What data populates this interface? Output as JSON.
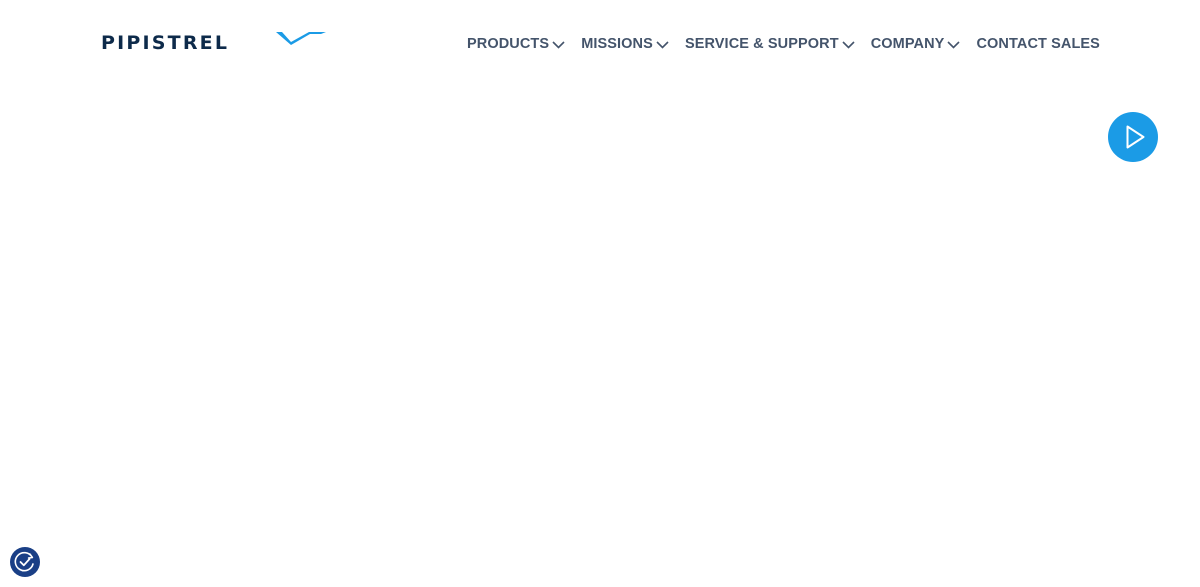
{
  "brand": {
    "name": "PIPISTREL",
    "logo_icon": "swallow-wing-icon",
    "text_color": "#0d2a4a",
    "accent_color": "#1b9be6"
  },
  "nav": {
    "items": [
      {
        "label": "PRODUCTS",
        "has_dropdown": true,
        "icon": "chevron-down-icon"
      },
      {
        "label": "MISSIONS",
        "has_dropdown": true,
        "icon": "chevron-down-icon"
      },
      {
        "label": "SERVICE & SUPPORT",
        "has_dropdown": true,
        "icon": "chevron-down-icon"
      },
      {
        "label": "COMPANY",
        "has_dropdown": true,
        "icon": "chevron-down-icon"
      },
      {
        "label": "CONTACT SALES",
        "has_dropdown": false
      }
    ],
    "text_color": "#44546b"
  },
  "video": {
    "play_icon": "play-icon",
    "button_color": "#1b9be6"
  },
  "consent": {
    "icon": "cookie-consent-icon",
    "button_color": "#1a3f86"
  }
}
